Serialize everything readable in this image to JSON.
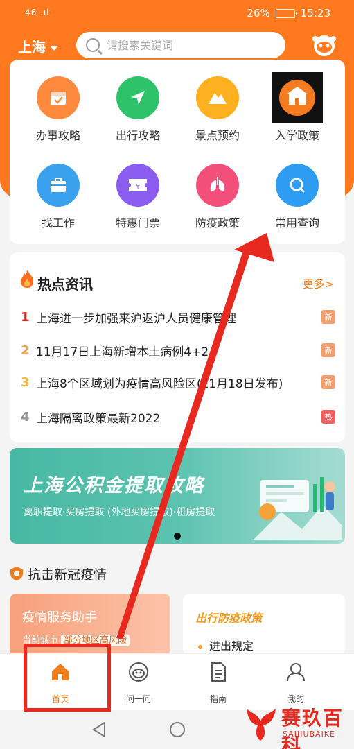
{
  "status_bar": {
    "signal": "46 .ıl",
    "battery_percent": "26%",
    "battery_level": 0.26,
    "time": "15:23"
  },
  "header": {
    "city": "上海",
    "search_placeholder": "请搜索关键词"
  },
  "quick_menu": [
    {
      "label": "办事攻略",
      "icon": "calendar-check-icon",
      "color": "#ff8a3d"
    },
    {
      "label": "出行攻略",
      "icon": "navigation-arrow-icon",
      "color": "#2ec36a"
    },
    {
      "label": "景点预约",
      "icon": "mountain-icon",
      "color": "#ffb01f"
    },
    {
      "label": "入学政策",
      "icon": "school-building-icon",
      "color": "#f47b20"
    },
    {
      "label": "找工作",
      "icon": "briefcase-icon",
      "color": "#3aa1ee"
    },
    {
      "label": "特惠门票",
      "icon": "ticket-icon",
      "color": "#8b5cf0"
    },
    {
      "label": "防疫政策",
      "icon": "lungs-icon",
      "color": "#f24f7a"
    },
    {
      "label": "常用查询",
      "icon": "search-icon",
      "color": "#2d9cf2"
    }
  ],
  "hot_news": {
    "title": "热点资讯",
    "more": "更多>",
    "items": [
      {
        "rank": "1",
        "text": "上海进一步加强来沪返沪人员健康管理",
        "badge": "新",
        "rank_color": "#e8291f",
        "badge_color": "#f0a070"
      },
      {
        "rank": "2",
        "text": "11月17日上海新增本土病例4+2",
        "badge": "新",
        "rank_color": "#f0a050",
        "badge_color": "#f0a070"
      },
      {
        "rank": "3",
        "text": "上海8个区域划为疫情高风险区(11月18日发布)",
        "badge": "新",
        "rank_color": "#f2b63c",
        "badge_color": "#f0a070"
      },
      {
        "rank": "4",
        "text": "上海隔离政策最新2022",
        "badge": "热",
        "rank_color": "#999999",
        "badge_color": "#f06060"
      }
    ]
  },
  "banner": {
    "title": "上海公积金提取攻略",
    "subtitle": "离职提取·买房提取 (外地买房提取)·租房提取"
  },
  "covid_section": {
    "title": "抗击新冠疫情",
    "service_title": "疫情服务助手",
    "service_sub_prefix": "当前城市",
    "service_sub_tag": "部分地区高风险",
    "policy_title": "出行防疫政策",
    "policy_item": "进出规定"
  },
  "tab_bar": [
    {
      "label": "首页",
      "icon": "home-icon"
    },
    {
      "label": "问一问",
      "icon": "chat-robot-icon"
    },
    {
      "label": "指南",
      "icon": "document-icon"
    },
    {
      "label": "我的",
      "icon": "user-icon"
    }
  ],
  "watermark": {
    "title": "赛玖百科",
    "subtitle": "SAIJIUBAIKE"
  },
  "colors": {
    "brand_orange": "#ff7a1f",
    "annotation_red": "#e8291f"
  }
}
